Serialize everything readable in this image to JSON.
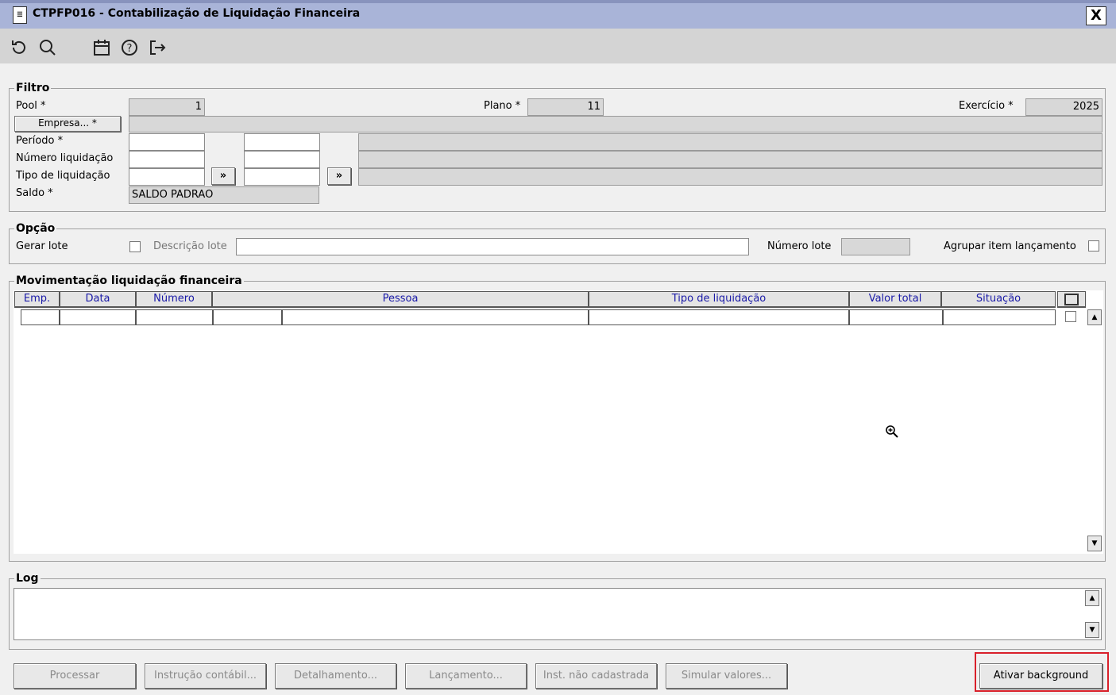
{
  "window": {
    "title": "CTPFP016 - Contabilização de Liquidação Financeira",
    "close_label": "X"
  },
  "toolbar": {
    "icons": [
      "refresh-icon",
      "search-icon",
      "calendar-icon",
      "help-icon",
      "exit-icon"
    ]
  },
  "filtro": {
    "legend": "Filtro",
    "pool_label": "Pool *",
    "pool_value": "1",
    "plano_label": "Plano *",
    "plano_value": "11",
    "exercicio_label": "Exercício *",
    "exercicio_value": "2025",
    "empresa_button": "Empresa... *",
    "periodo_label": "Período *",
    "numero_liquidacao_label": "Número liquidação",
    "tipo_liquidacao_label": "Tipo de liquidação",
    "lookup_button": "»",
    "saldo_label": "Saldo *",
    "saldo_value": "SALDO PADRAO"
  },
  "opcao": {
    "legend": "Opção",
    "gerar_lote_label": "Gerar lote",
    "descricao_lote_label": "Descrição lote",
    "numero_lote_label": "Número lote",
    "agrupar_label": "Agrupar item lançamento"
  },
  "movimentacao": {
    "legend": "Movimentação liquidação financeira",
    "columns": [
      "Emp.",
      "Data",
      "Número",
      "Pessoa",
      "Tipo de liquidação",
      "Valor total",
      "Situação"
    ]
  },
  "log": {
    "legend": "Log"
  },
  "footer": {
    "processar": "Processar",
    "instrucao": "Instrução contábil...",
    "detalhamento": "Detalhamento...",
    "lancamento": "Lançamento...",
    "inst_nao_cadastrada": "Inst. não cadastrada",
    "simular": "Simular valores...",
    "ativar_background": "Ativar background"
  },
  "colors": {
    "titlebar": "#a9b4d8",
    "grid_header_text": "#1a1aa8",
    "highlight": "#d9202a"
  }
}
